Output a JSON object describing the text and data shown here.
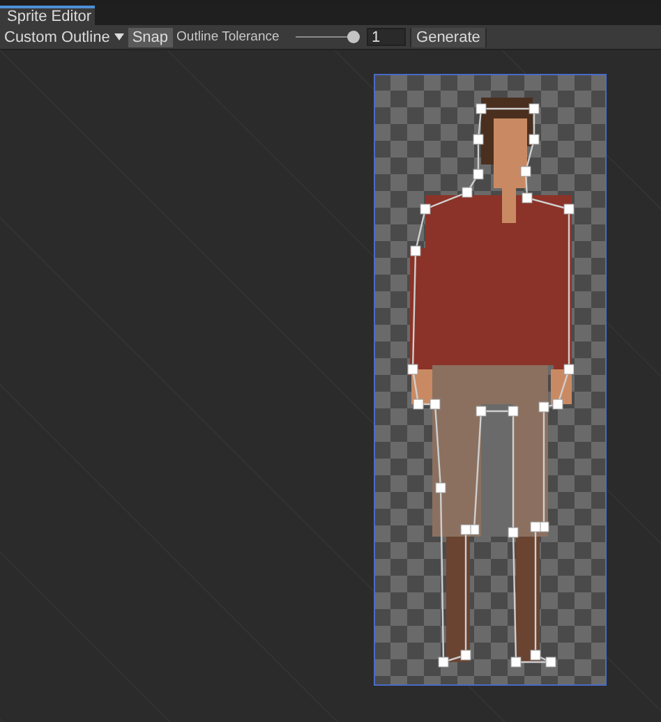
{
  "window": {
    "tabs": [
      {
        "label": "Sprite Editor",
        "selected": true
      }
    ]
  },
  "toolbar": {
    "mode_dropdown": "Custom Outline",
    "snap": {
      "label": "Snap",
      "on": true
    },
    "tolerance": {
      "label": "Outline Tolerance",
      "level": 0.95,
      "value": "1"
    },
    "generate_button": "Generate"
  }
}
